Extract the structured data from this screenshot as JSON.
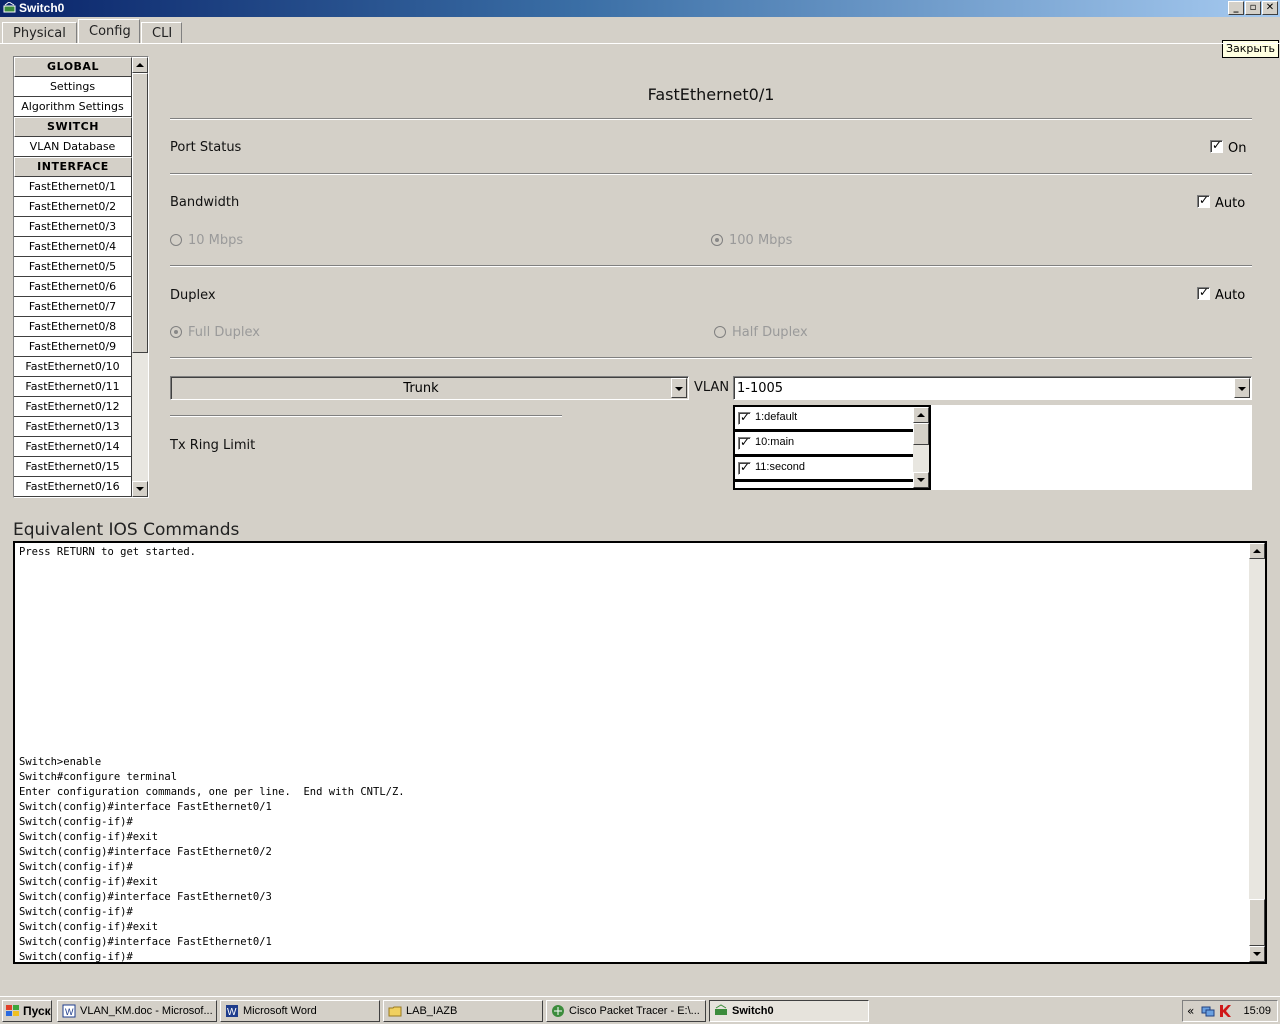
{
  "window": {
    "title": "Switch0",
    "close_tooltip": "Закрыть"
  },
  "tabs": [
    {
      "label": "Physical"
    },
    {
      "label": "Config",
      "active": true
    },
    {
      "label": "CLI"
    }
  ],
  "nav": {
    "sections": {
      "global": "GLOBAL",
      "switch": "SWITCH",
      "interface": "INTERFACE"
    },
    "items": {
      "settings": "Settings",
      "algorithm": "Algorithm Settings",
      "vlan_db": "VLAN Database"
    },
    "interfaces": [
      "FastEthernet0/1",
      "FastEthernet0/2",
      "FastEthernet0/3",
      "FastEthernet0/4",
      "FastEthernet0/5",
      "FastEthernet0/6",
      "FastEthernet0/7",
      "FastEthernet0/8",
      "FastEthernet0/9",
      "FastEthernet0/10",
      "FastEthernet0/11",
      "FastEthernet0/12",
      "FastEthernet0/13",
      "FastEthernet0/14",
      "FastEthernet0/15",
      "FastEthernet0/16"
    ]
  },
  "config": {
    "port_title": "FastEthernet0/1",
    "port_status": {
      "label": "Port Status",
      "checkbox_label": "On",
      "checked": true
    },
    "bandwidth": {
      "label": "Bandwidth",
      "auto_label": "Auto",
      "auto_checked": true,
      "opt_10": "10 Mbps",
      "opt_100": "100 Mbps",
      "selected": "100 Mbps"
    },
    "duplex": {
      "label": "Duplex",
      "auto_label": "Auto",
      "auto_checked": true,
      "opt_full": "Full Duplex",
      "opt_half": "Half Duplex",
      "selected": "Full Duplex"
    },
    "mode_select": "Trunk",
    "vlan_label": "VLAN",
    "vlan_select": "1-1005",
    "vlan_list": [
      {
        "label": "1:default",
        "checked": true
      },
      {
        "label": "10:main",
        "checked": true
      },
      {
        "label": "11:second",
        "checked": true
      }
    ],
    "tx_ring": "Tx Ring Limit"
  },
  "ios": {
    "title": "Equivalent IOS Commands",
    "lines": "Press RETURN to get started.\n\n\n\n\n\n\n\n\n\n\n\n\n\nSwitch>enable\nSwitch#configure terminal\nEnter configuration commands, one per line.  End with CNTL/Z.\nSwitch(config)#interface FastEthernet0/1\nSwitch(config-if)#\nSwitch(config-if)#exit\nSwitch(config)#interface FastEthernet0/2\nSwitch(config-if)#\nSwitch(config-if)#exit\nSwitch(config)#interface FastEthernet0/3\nSwitch(config-if)#\nSwitch(config-if)#exit\nSwitch(config)#interface FastEthernet0/1\nSwitch(config-if)#"
  },
  "taskbar": {
    "start": "Пуск",
    "tasks": [
      "VLAN_KM.doc - Microsof...",
      "Microsoft Word",
      "LAB_IAZB",
      "Cisco Packet Tracer - E:\\...",
      "Switch0"
    ],
    "tray_arrow": "«",
    "clock": "15:09"
  },
  "colors": {
    "title_start": "#0a246a",
    "title_end": "#a6caf0",
    "face": "#d4d0c8"
  }
}
